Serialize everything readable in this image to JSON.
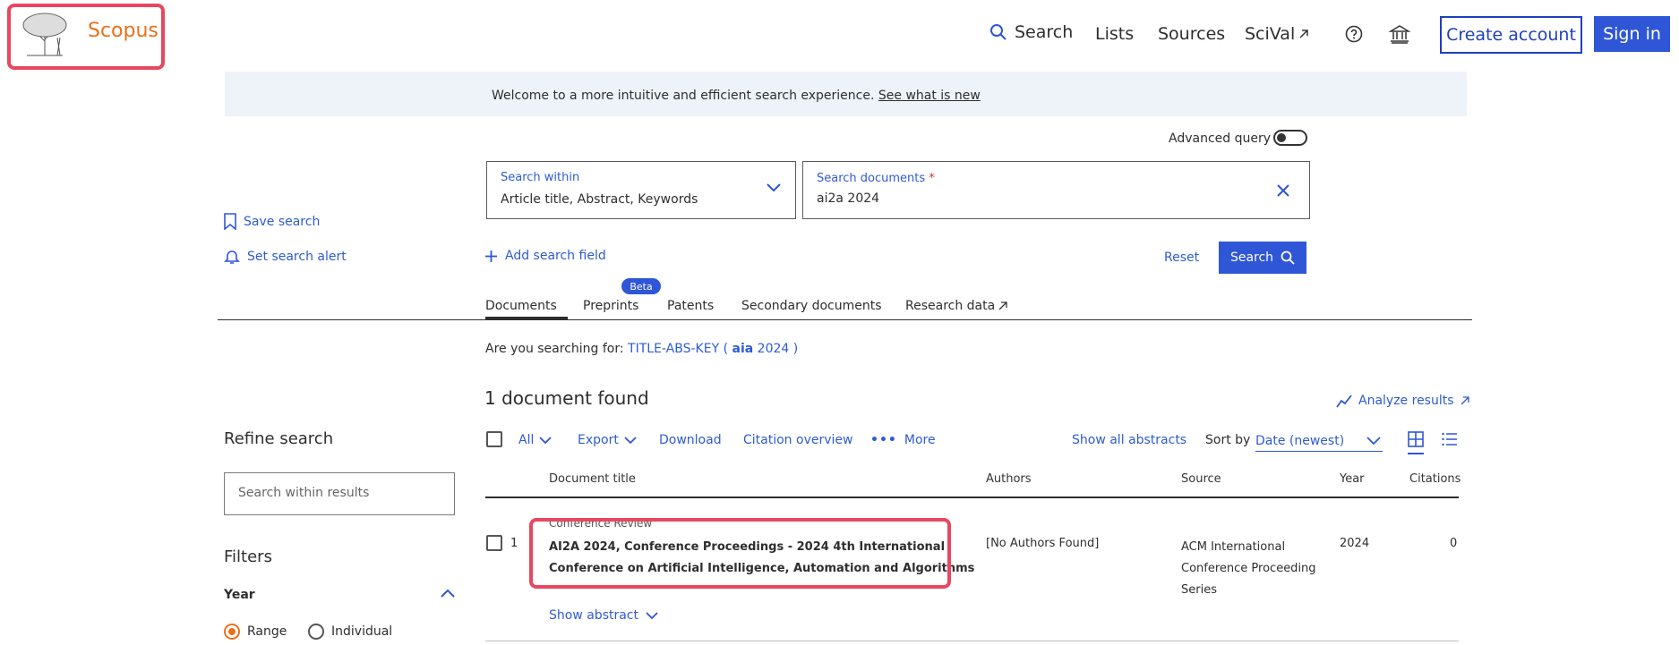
{
  "header": {
    "brand": "Scopus",
    "nav": {
      "search": "Search",
      "lists": "Lists",
      "sources": "Sources",
      "scival": "SciVal"
    },
    "create_account": "Create account",
    "sign_in": "Sign in"
  },
  "banner": {
    "text": "Welcome to a more intuitive and efficient search experience.",
    "link": "See what is new"
  },
  "search_panel": {
    "advanced_query": "Advanced query",
    "within_label": "Search within",
    "within_value": "Article title, Abstract, Keywords",
    "docs_label": "Search documents",
    "docs_required": "*",
    "docs_value": "ai2a 2024",
    "add_field": "Add search field",
    "reset": "Reset",
    "search": "Search"
  },
  "left": {
    "save_search": "Save search",
    "set_alert": "Set search alert"
  },
  "tabs": [
    {
      "label": "Documents"
    },
    {
      "label": "Preprints",
      "badge": "Beta"
    },
    {
      "label": "Patents"
    },
    {
      "label": "Secondary documents"
    },
    {
      "label": "Research data"
    }
  ],
  "suggestion": {
    "prefix": "Are you searching for:",
    "pre": "TITLE-ABS-KEY (",
    "bold": "aia",
    "post": "2024 )"
  },
  "results": {
    "count_text": "1 document found",
    "analyze": "Analyze results",
    "toolbar": {
      "all": "All",
      "export": "Export",
      "download": "Download",
      "citation_overview": "Citation overview",
      "more": "More",
      "show_all_abstracts": "Show all abstracts",
      "sort_by": "Sort by",
      "sort_value": "Date (newest)"
    },
    "columns": {
      "title": "Document title",
      "authors": "Authors",
      "source": "Source",
      "year": "Year",
      "citations": "Citations"
    },
    "rows": [
      {
        "num": "1",
        "type": "Conference Review",
        "title_line1": "AI2A 2024, Conference Proceedings - 2024 4th International",
        "title_line2": "Conference on Artificial Intelligence, Automation and Algorithms",
        "authors": "[No Authors Found]",
        "source_line1": "ACM International",
        "source_line2": "Conference Proceeding",
        "source_line3": "Series",
        "year": "2024",
        "citations": "0",
        "show_abstract": "Show abstract"
      }
    ]
  },
  "refine": {
    "title": "Refine search",
    "placeholder": "Search within results",
    "filters": "Filters",
    "year": "Year",
    "range": "Range",
    "individual": "Individual"
  },
  "colors": {
    "accent": "#2e56d6",
    "link": "#2e5bd4",
    "highlight": "#e8475f",
    "brand": "#e9711c"
  }
}
